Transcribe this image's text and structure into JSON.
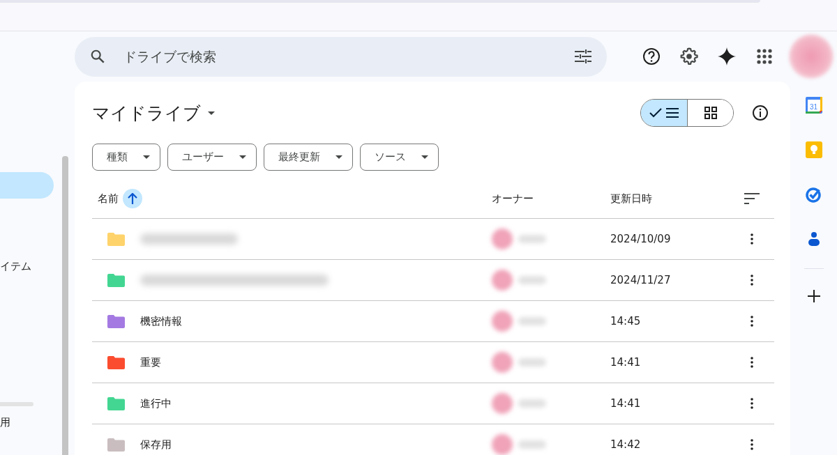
{
  "search": {
    "placeholder": "ドライブで検索"
  },
  "sidebar": {
    "items": [
      {
        "selected": true
      },
      {
        "label": "イテム",
        "selected": false
      }
    ],
    "storage_label": "用"
  },
  "title": "マイドライブ",
  "view_toggle": [
    {
      "kind": "list",
      "selected": true
    },
    {
      "kind": "grid",
      "selected": false
    }
  ],
  "filters": [
    "種類",
    "ユーザー",
    "最終更新",
    "ソース"
  ],
  "table": {
    "columns": [
      "名前",
      "オーナー",
      "更新日時"
    ],
    "rows": [
      {
        "name_hidden": true,
        "color": "#ffd36b",
        "modified": "2024/10/09"
      },
      {
        "name_hidden": true,
        "color": "#43d692",
        "modified": "2024/11/27"
      },
      {
        "name": "機密情報",
        "name_hidden": false,
        "color": "#a47ae2",
        "modified": "14:45"
      },
      {
        "name": "重要",
        "name_hidden": false,
        "color": "#fb4c2f",
        "modified": "14:41"
      },
      {
        "name": "進行中",
        "name_hidden": false,
        "color": "#43d692",
        "modified": "14:41"
      },
      {
        "name": "保存用",
        "name_hidden": false,
        "color": "#cabdbf",
        "modified": "14:42"
      }
    ]
  },
  "rail": [
    {
      "kind": "calendar",
      "label": "31"
    },
    {
      "kind": "keep"
    },
    {
      "kind": "tasks"
    },
    {
      "kind": "contacts"
    }
  ]
}
